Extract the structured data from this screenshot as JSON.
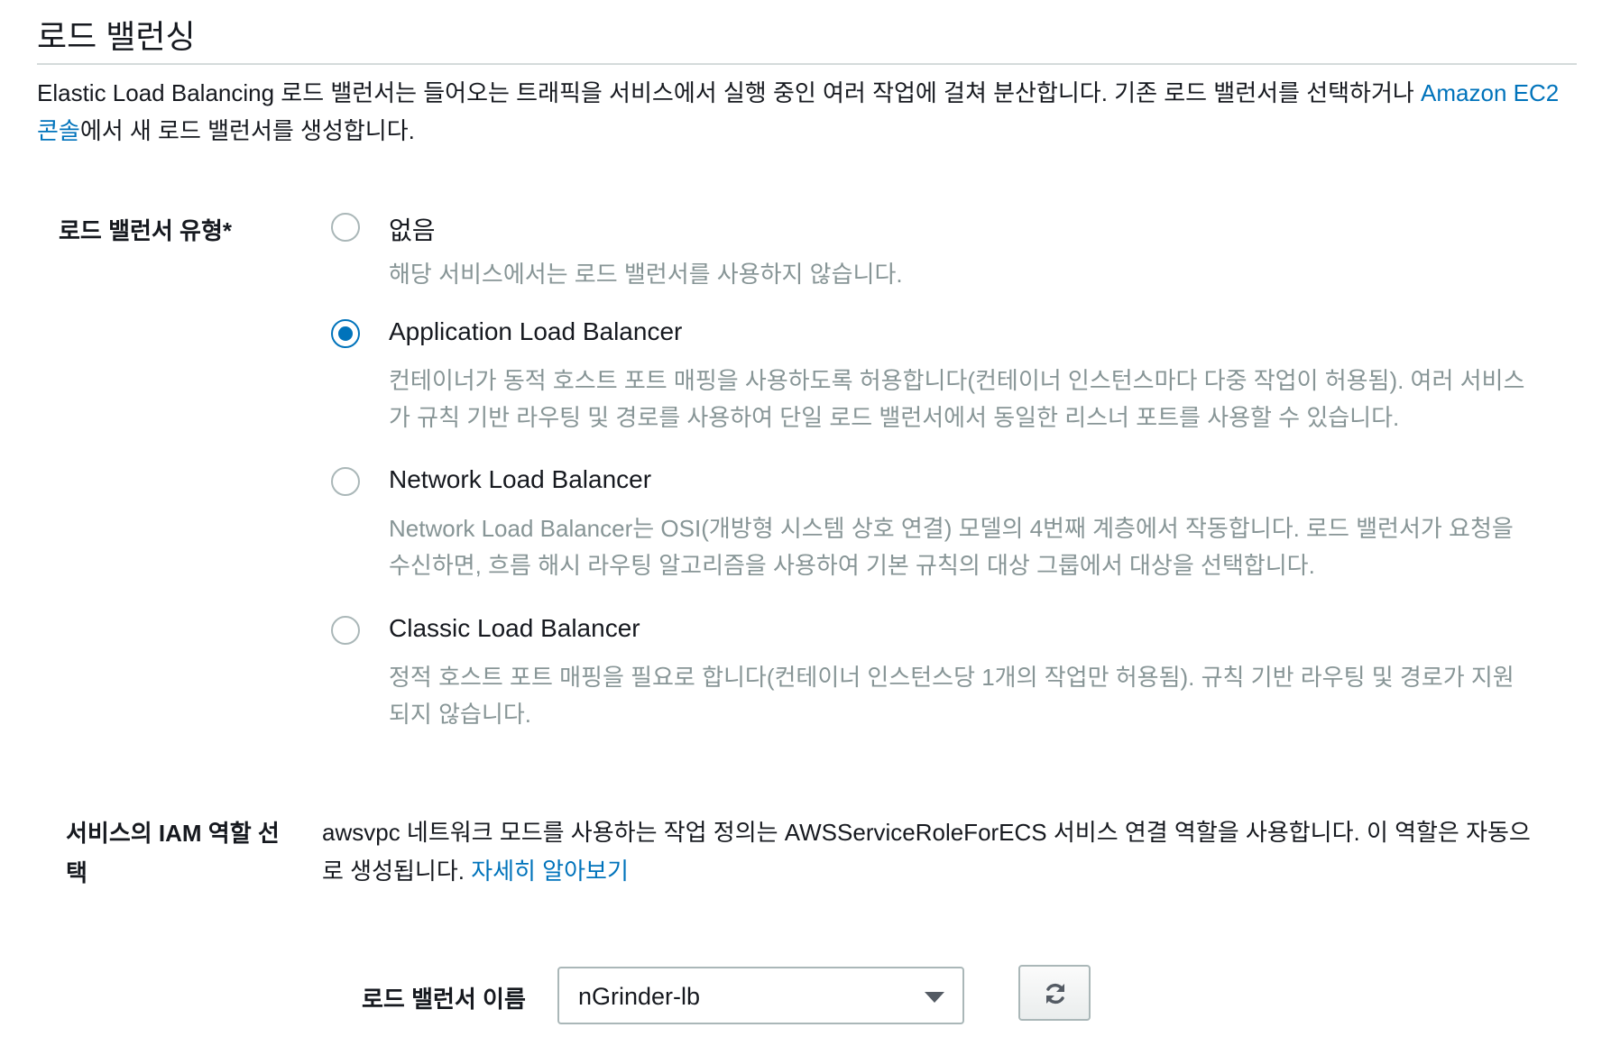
{
  "section": {
    "title": "로드 밸런싱",
    "intro_text": "Elastic Load Balancing 로드 밸런서는 들어오는 트래픽을 서비스에서 실행 중인 여러 작업에 걸쳐 분산합니다. 기존 로드 밸런서를 선택하거나 ",
    "intro_link": "Amazon EC2 콘솔",
    "intro_text_after": "에서 새 로드 밸런서를 생성합니다."
  },
  "load_balancer_type": {
    "label": "로드 밸런서 유형*",
    "selected": "Application Load Balancer",
    "options": [
      {
        "label": "없음",
        "description": "해당 서비스에서는 로드 밸런서를 사용하지 않습니다.",
        "checked": false
      },
      {
        "label": "Application Load Balancer",
        "description": "컨테이너가 동적 호스트 포트 매핑을 사용하도록 허용합니다(컨테이너 인스턴스마다 다중 작업이 허용됨). 여러 서비스가 규칙 기반 라우팅 및 경로를 사용하여 단일 로드 밸런서에서 동일한 리스너 포트를 사용할 수 있습니다.",
        "checked": true
      },
      {
        "label": "Network Load Balancer",
        "description": "Network Load Balancer는 OSI(개방형 시스템 상호 연결) 모델의 4번째 계층에서 작동합니다. 로드 밸런서가 요청을 수신하면, 흐름 해시 라우팅 알고리즘을 사용하여 기본 규칙의 대상 그룹에서 대상을 선택합니다.",
        "checked": false
      },
      {
        "label": "Classic Load Balancer",
        "description": "정적 호스트 포트 매핑을 필요로 합니다(컨테이너 인스턴스당 1개의 작업만 허용됨). 규칙 기반 라우팅 및 경로가 지원되지 않습니다.",
        "checked": false
      }
    ]
  },
  "iam_role": {
    "label": "서비스의 IAM 역할 선택",
    "description": "awsvpc 네트워크 모드를 사용하는 작업 정의는 AWSServiceRoleForECS 서비스 연결 역할을 사용합니다. 이 역할은 자동으로 생성됩니다. ",
    "learn_more": "자세히 알아보기"
  },
  "load_balancer_name": {
    "label": "로드 밸런서 이름",
    "value": "nGrinder-lb",
    "dropdown_icon": "caret-down-icon",
    "refresh_icon": "refresh-icon"
  },
  "colors": {
    "link": "#0073bb",
    "radio_checked": "#0073bb",
    "muted_text": "#879596",
    "border": "#aab7b8"
  }
}
